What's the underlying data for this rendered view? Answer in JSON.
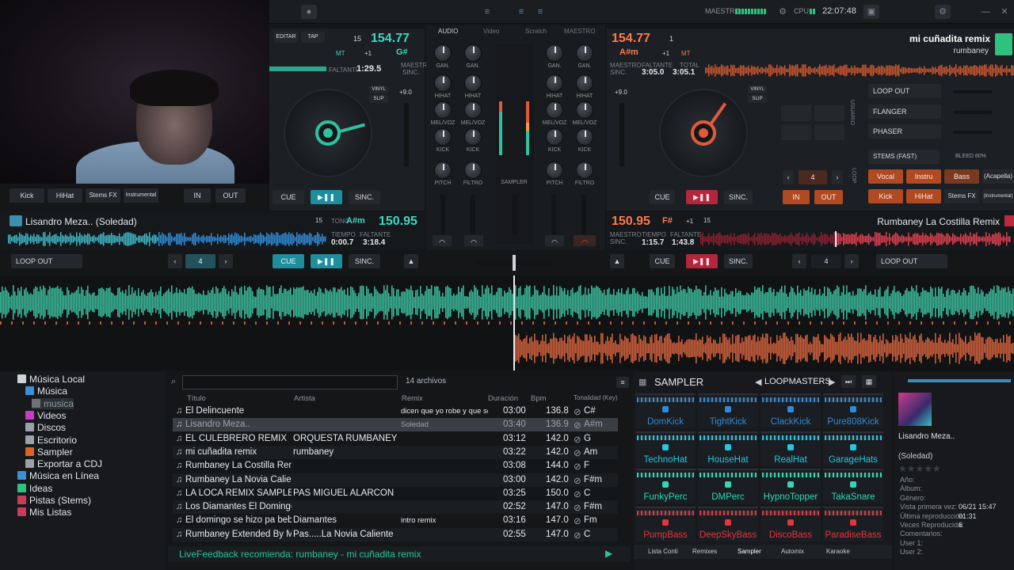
{
  "header": {
    "master_label": "MAESTRO",
    "cpu_label": "CPU",
    "clock": "22:07:48"
  },
  "deck_left": {
    "edit": "EDITAR",
    "tap": "TAP",
    "bpm": "154.77",
    "beat_count": "15",
    "key": "G#",
    "mt": "MT",
    "pitch_plus": "+1",
    "remaining_label": "FALTANTI",
    "remaining": "1:29.5",
    "master_label": "MAESTRO",
    "sync_label": "SINC.",
    "vinyl": "VINYL",
    "slip": "SLIP",
    "pitch_range": "+9.0",
    "pads": [
      "Kick",
      "HiHat",
      "Stems FX",
      "Instrumental"
    ],
    "in": "IN",
    "out": "OUT",
    "cue": "CUE",
    "sync": "SINC.",
    "track_title": "Lisandro Meza.. (Soledad)",
    "key_label": "TONO",
    "track_key": "A#m",
    "track_bpm": "150.95",
    "time_label": "TIEMPO",
    "time": "0:00.7",
    "left_label": "FALTANTE",
    "left": "3:18.4",
    "loop_label": "LOOP OUT",
    "loop_size": "4"
  },
  "mixer": {
    "tabs": [
      "AUDIO",
      "Video",
      "Scratch",
      "MAESTRO"
    ],
    "knobs": [
      "GAN.",
      "HIHAT",
      "MEL/VOZ",
      "KICK"
    ],
    "pitch": "PITCH",
    "filter": "FILTRO",
    "sampler": "SAMPLER"
  },
  "deck_right": {
    "bpm": "154.77",
    "beat_count": "1",
    "key": "A#m",
    "pitch_plus": "+1",
    "mt": "MT",
    "master_label": "MAESTRO",
    "remaining_label": "FALTANTE",
    "total_label": "TOTAL",
    "sync_label": "SINC.",
    "remaining": "3:05.0",
    "total": "3:05.1",
    "now_title": "mi cuñadita remix",
    "now_artist": "rumbaney",
    "vinyl": "VINYL",
    "slip": "SLIP",
    "pitch_range": "+9.0",
    "fx": [
      "LOOP OUT",
      "FLANGER",
      "PHASER"
    ],
    "stems_label": "STEMS (FAST)",
    "bleed_label": "BLEED 80%",
    "usuario": "USUARIO",
    "loop_vertical": "LOOP",
    "loop_size": "4",
    "stems": [
      "Vocal",
      "Instru",
      "Bass",
      "(Acapella)"
    ],
    "pads": [
      "Kick",
      "HiHat",
      "Stems FX",
      "(Instrumental)"
    ],
    "in": "IN",
    "out": "OUT",
    "cue": "CUE",
    "sync": "SINC.",
    "track_bpm": "150.95",
    "track_key": "F#",
    "track_pitch": "+1",
    "track_beat": "15",
    "track_title": "Rumbaney La Costilla Remix",
    "time_label": "TIEMPO",
    "time": "1:15.7",
    "left_label": "FALTANTE",
    "left": "1:43.8",
    "loop_label": "LOOP OUT",
    "loop_size2": "4"
  },
  "browser": {
    "tree": [
      "Música Local",
      "Música",
      "musica",
      "Videos",
      "Discos",
      "Escritorio",
      "Sampler",
      "Exportar a CDJ",
      "Música en Línea",
      "Ideas",
      "Pistas (Stems)",
      "Mis Listas"
    ],
    "files_count": "14 archivos",
    "columns": [
      "Título",
      "Artista",
      "Remix",
      "Duración",
      "Bpm",
      "Tonalidad (Key)"
    ],
    "rows": [
      {
        "title": "El Delincuente",
        "artist": "",
        "remix": "dicen que yo robe y que so...",
        "dur": "03:00",
        "bpm": "136.8",
        "key": "C#"
      },
      {
        "title": "Lisandro Meza..",
        "artist": "",
        "remix": "Soledad",
        "dur": "03:40",
        "bpm": "136.9",
        "key": "A#m"
      },
      {
        "title": "EL CULEBRERO REMIX",
        "artist": "ORQUESTA RUMBANEY",
        "remix": "",
        "dur": "03:12",
        "bpm": "142.0",
        "key": "G"
      },
      {
        "title": "mi cuñadita remix",
        "artist": "rumbaney",
        "remix": "",
        "dur": "03:22",
        "bpm": "142.0",
        "key": "Am"
      },
      {
        "title": "Rumbaney La Costilla Remix",
        "artist": "",
        "remix": "",
        "dur": "03:08",
        "bpm": "144.0",
        "key": "F"
      },
      {
        "title": "Rumbaney La Novia Caliente Remix",
        "artist": "",
        "remix": "",
        "dur": "03:00",
        "bpm": "142.0",
        "key": "F#m"
      },
      {
        "title": "LA LOCA REMIX SAMPLE CESAR...",
        "artist": "PAS MIGUEL ALARCON",
        "remix": "",
        "dur": "03:25",
        "bpm": "150.0",
        "key": "C"
      },
      {
        "title": "Los Diamantes   El Domingo Se H...",
        "artist": "",
        "remix": "",
        "dur": "02:52",
        "bpm": "147.0",
        "key": "F#m"
      },
      {
        "title": "El domingo se hizo pa beber",
        "artist": "Diamantes",
        "remix": "intro remix",
        "dur": "03:16",
        "bpm": "147.0",
        "key": "Fm"
      },
      {
        "title": "Rumbaney Extended By Mauricio...",
        "artist": "Pas.....La Novia Caliente",
        "remix": "",
        "dur": "02:55",
        "bpm": "147.0",
        "key": "C"
      }
    ],
    "live_feedback": "LiveFeedback recomienda: rumbaney - mi cuñadita remix"
  },
  "sampler": {
    "title": "SAMPLER",
    "bank": "LOOPMASTERS",
    "pads": [
      {
        "name": "DomKick",
        "color": "#2f8ad8"
      },
      {
        "name": "TightKick",
        "color": "#2f8ad8"
      },
      {
        "name": "ClackKick",
        "color": "#2f8ad8"
      },
      {
        "name": "Pure808Kick",
        "color": "#2f8ad8"
      },
      {
        "name": "TechnoHat",
        "color": "#27c6e0"
      },
      {
        "name": "HouseHat",
        "color": "#27c6e0"
      },
      {
        "name": "RealHat",
        "color": "#27c6e0"
      },
      {
        "name": "GarageHats",
        "color": "#27c6e0"
      },
      {
        "name": "FunkyPerc",
        "color": "#2fd9b8"
      },
      {
        "name": "DMPerc",
        "color": "#2fd9b8"
      },
      {
        "name": "HypnoTopper",
        "color": "#2fd9b8"
      },
      {
        "name": "TakaSnare",
        "color": "#2fd9b8"
      },
      {
        "name": "PumpBass",
        "color": "#e0363f"
      },
      {
        "name": "DeepSkyBass",
        "color": "#e0363f"
      },
      {
        "name": "DiscoBass",
        "color": "#e0363f"
      },
      {
        "name": "ParadiseBass",
        "color": "#e0363f"
      }
    ],
    "tabs": [
      "Lista Conti",
      "Remixes",
      "Sampler",
      "Automix",
      "Karaoke"
    ]
  },
  "info": {
    "artist_title": "Lisandro Meza..",
    "subtitle": "(Soledad)",
    "fields": [
      {
        "k": "Año:",
        "v": ""
      },
      {
        "k": "Álbum:",
        "v": ""
      },
      {
        "k": "Género:",
        "v": ""
      },
      {
        "k": "Vista primera vez:",
        "v": "06/21 15:47"
      },
      {
        "k": "Última reproducción:",
        "v": "01:31"
      },
      {
        "k": "Veces Reproducida:",
        "v": "6"
      },
      {
        "k": "Comentarios:",
        "v": ""
      },
      {
        "k": "User 1:",
        "v": ""
      },
      {
        "k": "User 2:",
        "v": ""
      }
    ]
  }
}
